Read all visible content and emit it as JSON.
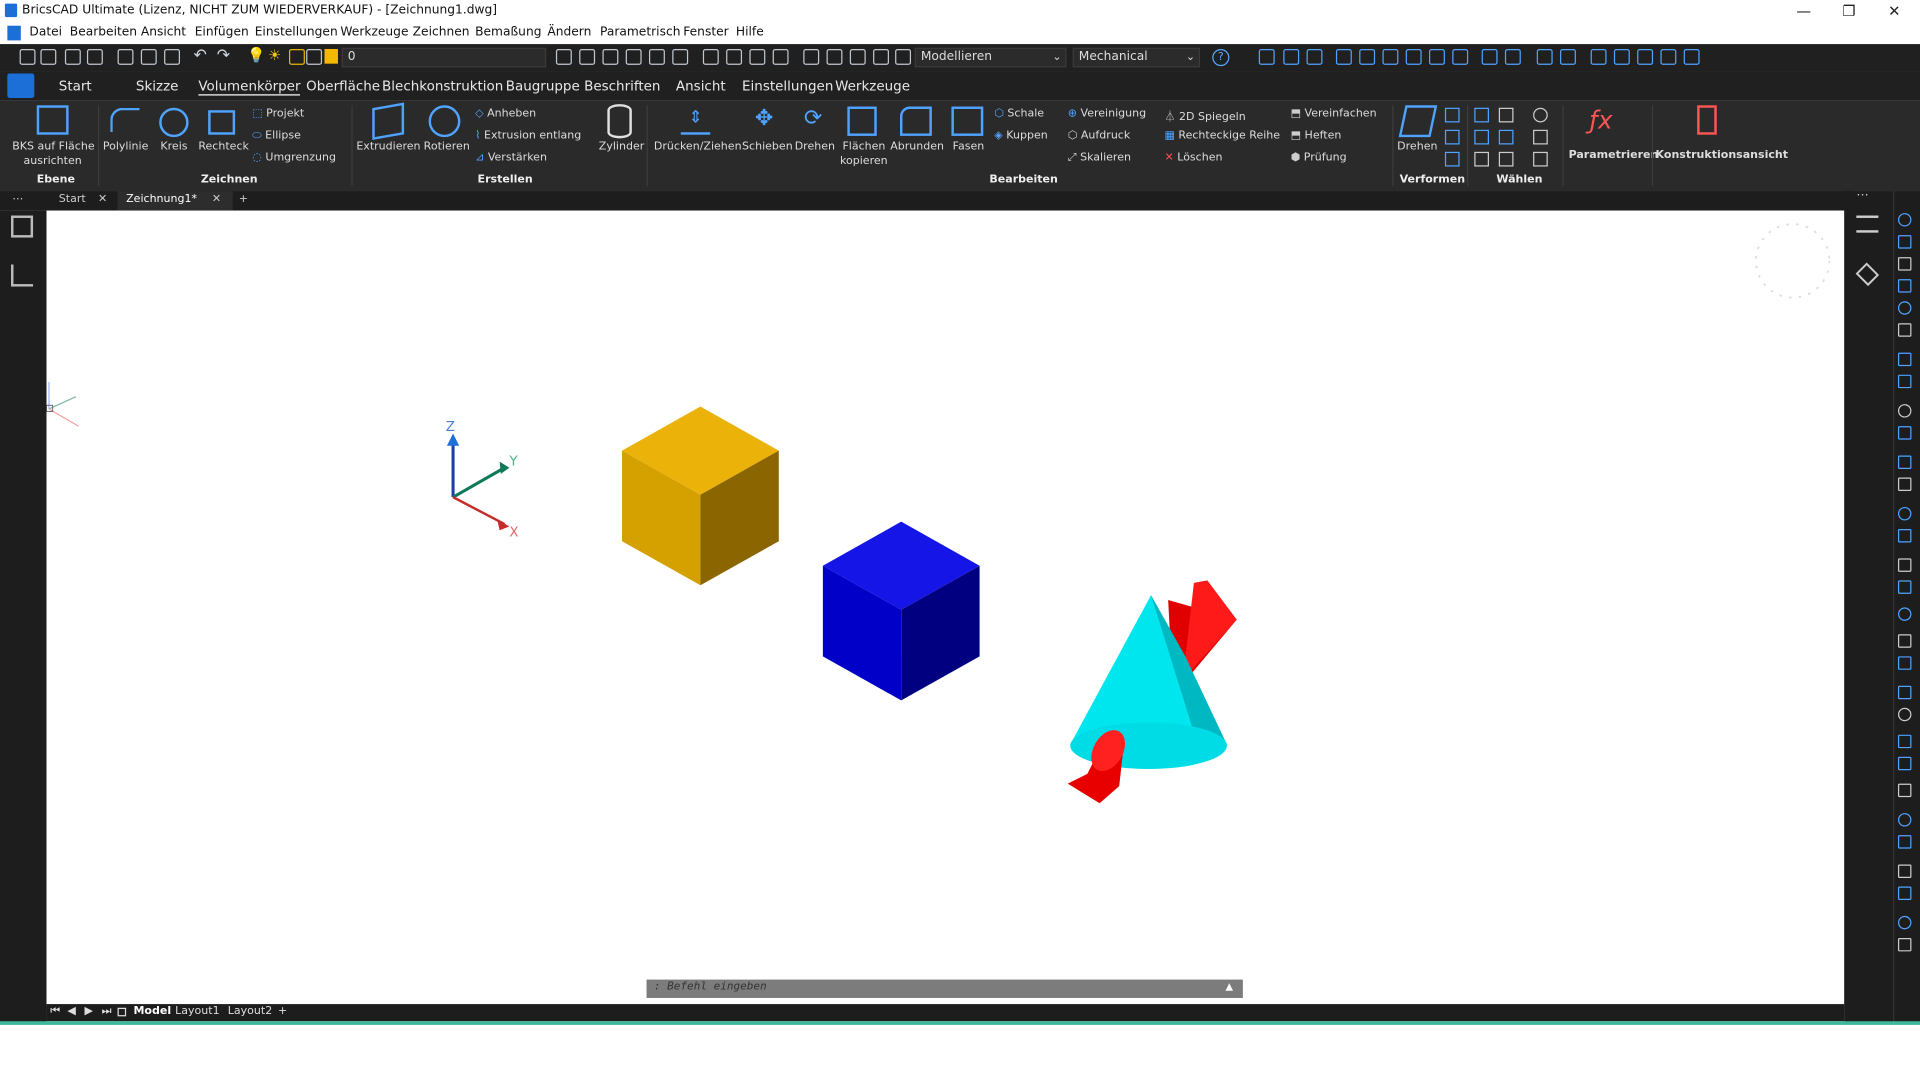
{
  "window": {
    "title": "BricsCAD Ultimate (Lizenz, NICHT ZUM WIEDERVERKAUF) - [Zeichnung1.dwg]",
    "minimize": "—",
    "restore": "❐",
    "close": "✕"
  },
  "menus": [
    "Datei",
    "Bearbeiten",
    "Ansicht",
    "Einfügen",
    "Einstellungen",
    "Werkzeuge",
    "Zeichnen",
    "Bemaßung",
    "Ändern",
    "Parametrisch",
    "Fenster",
    "Hilfe"
  ],
  "toolbar": {
    "layer": "0",
    "workspace": "Modellieren",
    "style": "Mechanical"
  },
  "ribbon_tabs": [
    "Start",
    "Skizze",
    "Volumenkörper",
    "Oberfläche",
    "Blechkonstruktion",
    "Baugruppe",
    "Beschriften",
    "Ansicht",
    "Einstellungen",
    "Werkzeuge"
  ],
  "active_tab": "Volumenkörper",
  "ribbon": {
    "bks": "BKS auf Fläche",
    "bks2": "ausrichten",
    "polylinie": "Polylinie",
    "kreis": "Kreis",
    "rechteck": "Rechteck",
    "projekt": "Projekt",
    "ellipse": "Ellipse",
    "umgrenzung": "Umgrenzung",
    "extrudieren": "Extrudieren",
    "rotieren": "Rotieren",
    "anheben": "Anheben",
    "extrusion": "Extrusion entlang",
    "verstaerken": "Verstärken",
    "zylinder": "Zylinder",
    "druecken": "Drücken/Ziehen",
    "schieben": "Schieben",
    "drehen": "Drehen",
    "flaechen": "Flächen",
    "kopieren": "kopieren",
    "abrunden": "Abrunden",
    "fasen": "Fasen",
    "schale": "Schale",
    "kuppen": "Kuppen",
    "vereinigung": "Vereinigung",
    "aufdruck": "Aufdruck",
    "skalieren": "Skalieren",
    "spiegeln": "2D Spiegeln",
    "reihe": "Rechteckige Reihe",
    "loeschen": "Löschen",
    "vereinfachen": "Vereinfachen",
    "heften": "Heften",
    "pruefung": "Prüfung",
    "drehen2": "Drehen",
    "parametrieren": "Parametrieren",
    "konstruktion": "Konstruktionsansicht",
    "groups": {
      "ebene": "Ebene",
      "zeichnen": "Zeichnen",
      "erstellen": "Erstellen",
      "bearbeiten": "Bearbeiten",
      "verformen": "Verformen",
      "waehlen": "Wählen"
    }
  },
  "doc_tabs": {
    "start": "Start",
    "drawing": "Zeichnung1*",
    "add": "+"
  },
  "axes": {
    "x": "X",
    "y": "Y",
    "z": "Z"
  },
  "command": {
    "placeholder": ": Befehl eingeben",
    "arrow": "▲"
  },
  "layout_tabs": [
    "Model",
    "Layout1",
    "Layout2"
  ],
  "layout_add": "+",
  "colors": {
    "gold": "#E8AF00",
    "blue": "#0A0ADC",
    "cyan": "#00E0E8",
    "red": "#E81010",
    "status": "#3db89c"
  }
}
